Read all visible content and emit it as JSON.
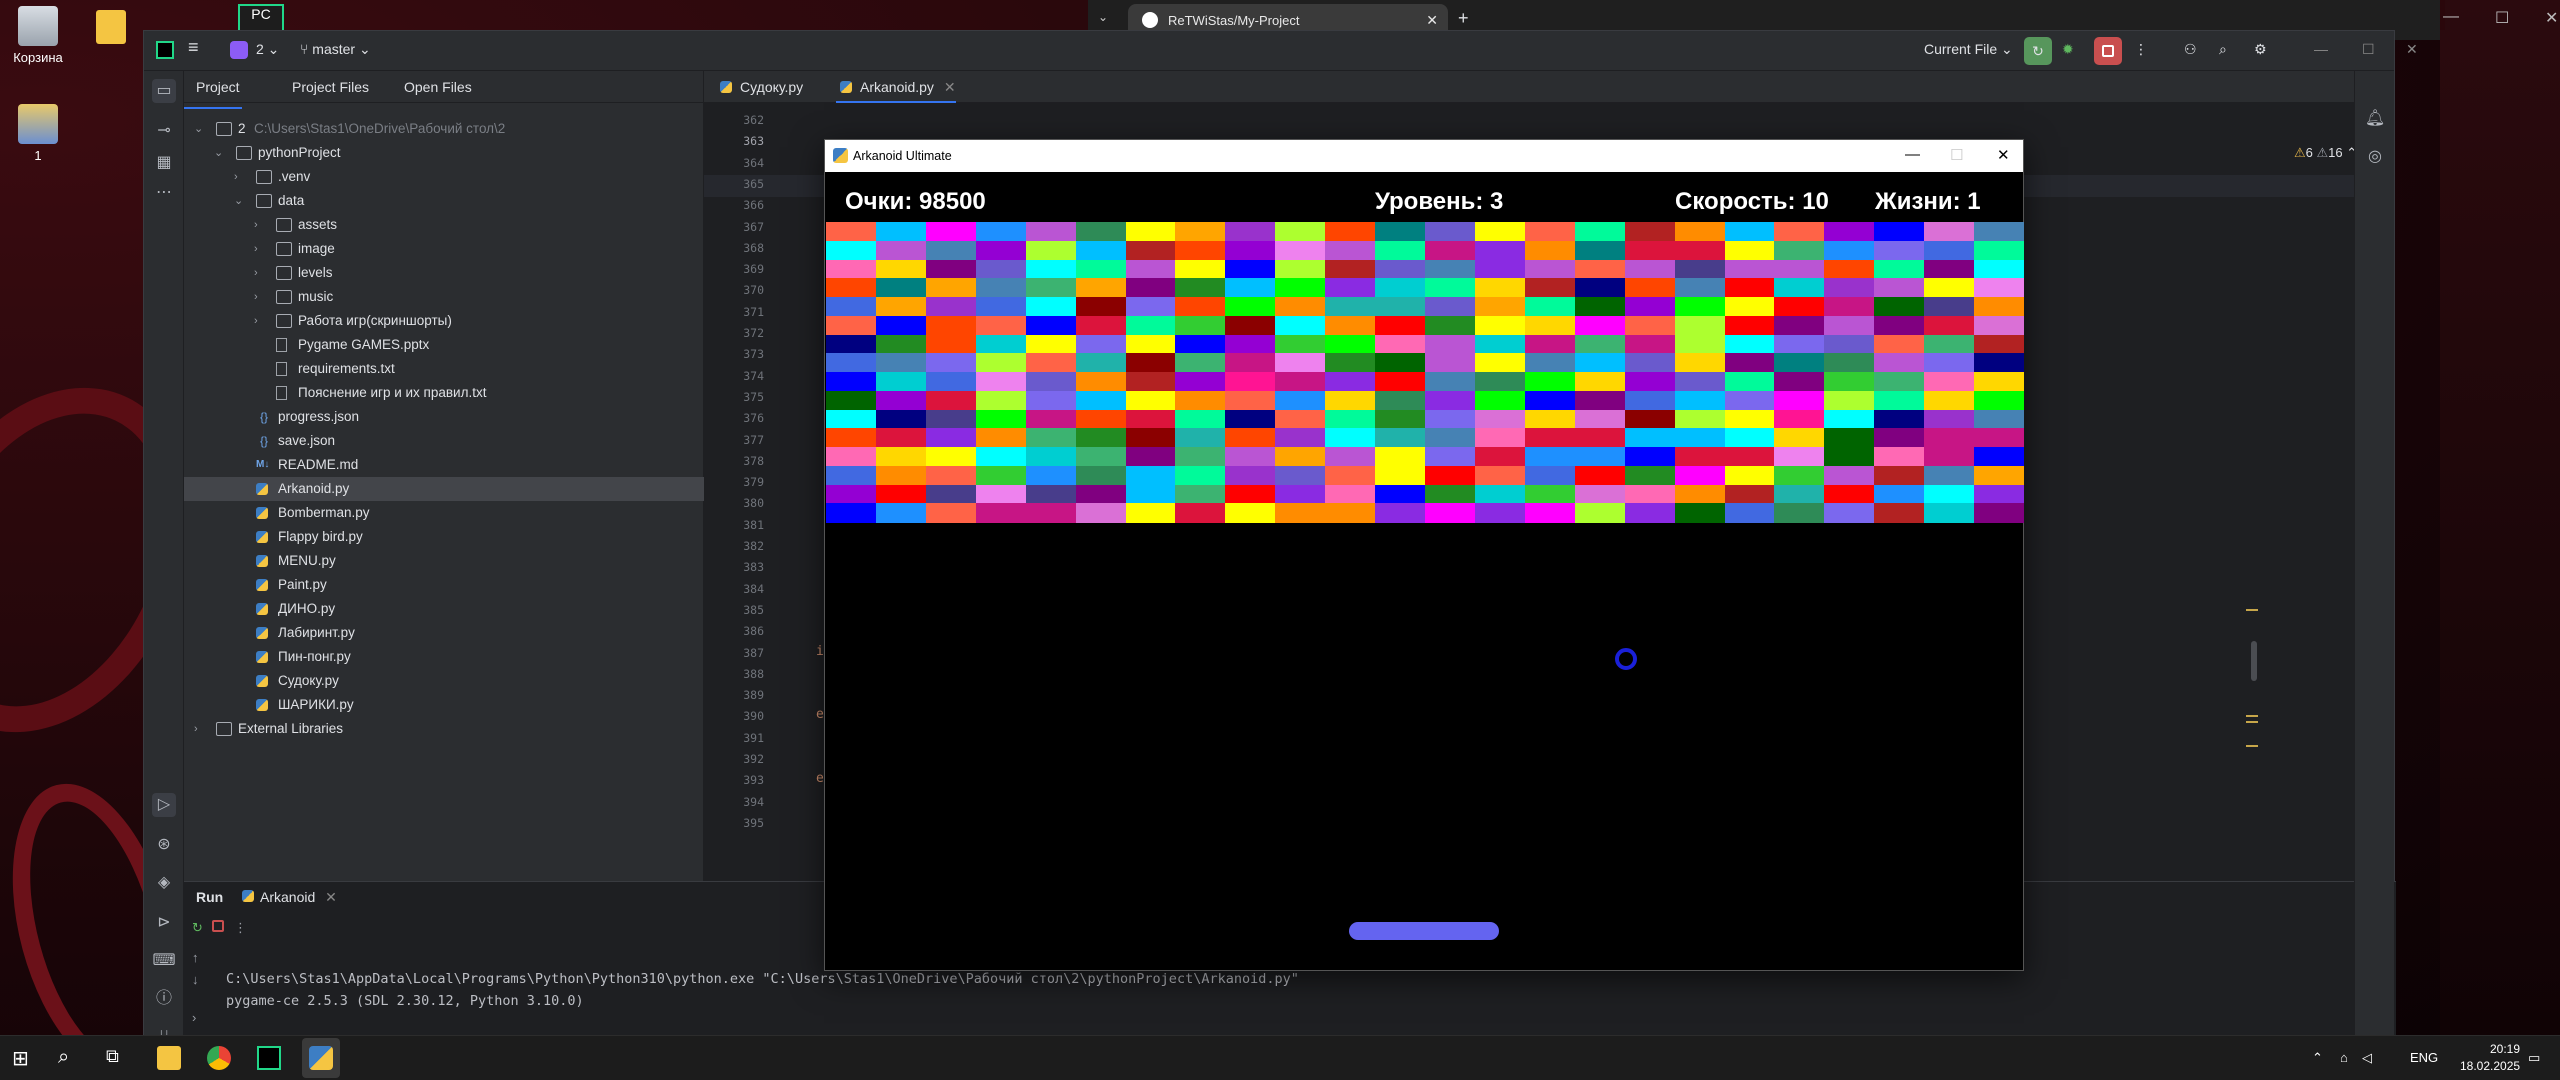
{
  "desktop": {
    "icons": [
      {
        "label": "Корзина"
      },
      {
        "label": "1"
      }
    ]
  },
  "browser": {
    "tab_title": "ReTWiStas/My-Project"
  },
  "ide": {
    "project_badge": "2",
    "branch": "master",
    "run_config": "Current File",
    "panel_tabs": [
      "Project",
      "Project Files",
      "Open Files"
    ],
    "tree": [
      {
        "label": "2",
        "suffix": "C:\\Users\\Stas1\\OneDrive\\Рабочий стол\\2",
        "depth": 0,
        "type": "folder",
        "open": true
      },
      {
        "label": "pythonProject",
        "depth": 1,
        "type": "folder",
        "open": true
      },
      {
        "label": ".venv",
        "depth": 2,
        "type": "folder",
        "open": false
      },
      {
        "label": "data",
        "depth": 2,
        "type": "folder",
        "open": true
      },
      {
        "label": "assets",
        "depth": 3,
        "type": "folder",
        "open": false
      },
      {
        "label": "image",
        "depth": 3,
        "type": "folder",
        "open": false
      },
      {
        "label": "levels",
        "depth": 3,
        "type": "folder",
        "open": false
      },
      {
        "label": "music",
        "depth": 3,
        "type": "folder",
        "open": false
      },
      {
        "label": "Работа игр(скриншорты)",
        "depth": 3,
        "type": "folder",
        "open": false
      },
      {
        "label": "Pygame GAMES.pptx",
        "depth": 3,
        "type": "file"
      },
      {
        "label": "requirements.txt",
        "depth": 3,
        "type": "file"
      },
      {
        "label": "Пояснение игр и их правил.txt",
        "depth": 3,
        "type": "file"
      },
      {
        "label": "progress.json",
        "depth": 2,
        "type": "json"
      },
      {
        "label": "save.json",
        "depth": 2,
        "type": "json"
      },
      {
        "label": "README.md",
        "depth": 2,
        "type": "md"
      },
      {
        "label": "Arkanoid.py",
        "depth": 2,
        "type": "py",
        "selected": true
      },
      {
        "label": "Bomberman.py",
        "depth": 2,
        "type": "py"
      },
      {
        "label": "Flappy bird.py",
        "depth": 2,
        "type": "py"
      },
      {
        "label": "MENU.py",
        "depth": 2,
        "type": "py"
      },
      {
        "label": "Paint.py",
        "depth": 2,
        "type": "py"
      },
      {
        "label": "ДИНО.py",
        "depth": 2,
        "type": "py"
      },
      {
        "label": "Лабиринт.py",
        "depth": 2,
        "type": "py"
      },
      {
        "label": "Пин-понг.py",
        "depth": 2,
        "type": "py"
      },
      {
        "label": "Судоку.py",
        "depth": 2,
        "type": "py"
      },
      {
        "label": "ШАРИКИ.py",
        "depth": 2,
        "type": "py"
      },
      {
        "label": "External Libraries",
        "depth": 0,
        "type": "lib"
      }
    ],
    "editor_tabs": [
      {
        "label": "Судоку.py",
        "active": false
      },
      {
        "label": "Arkanoid.py",
        "active": true
      }
    ],
    "line_numbers": [
      "362",
      "363",
      "364",
      "365",
      "366",
      "367",
      "368",
      "369",
      "370",
      "371",
      "372",
      "373",
      "374",
      "375",
      "376",
      "377",
      "378",
      "379",
      "380",
      "381",
      "382",
      "383",
      "384",
      "385",
      "386",
      "387",
      "388",
      "389",
      "390",
      "391",
      "392",
      "393",
      "394",
      "395"
    ],
    "current_line": "363",
    "code_fragments": [
      {
        "line": "387",
        "text": "i"
      },
      {
        "line": "390",
        "text": "e"
      },
      {
        "line": "393",
        "text": "e"
      }
    ],
    "warnings": "6",
    "weak_warnings": "16",
    "run": {
      "tab_run": "Run",
      "tab_config": "Arkanoid",
      "console": [
        "C:\\Users\\Stas1\\AppData\\Local\\Programs\\Python\\Python310\\python.exe \"C:\\Users\\Stas1\\OneDrive\\Рабочий стол\\2\\pythonProject\\Arkanoid.py\"",
        "pygame-ce 2.5.3 (SDL 2.30.12, Python 3.10.0)"
      ]
    }
  },
  "game": {
    "title": "Arkanoid Ultimate",
    "score": "Очки: 98500",
    "level": "Уровень: 3",
    "speed": "Скорость: 10",
    "lives": "Жизни: 1",
    "brick_colors": [
      "#ff0000",
      "#00ff00",
      "#0000ff",
      "#ffff00",
      "#ff00ff",
      "#00ffff",
      "#ff8c00",
      "#9400d3",
      "#ff1493",
      "#00fa9a",
      "#1e90ff",
      "#ff4500",
      "#32cd32",
      "#8a2be2",
      "#dc143c",
      "#00ced1",
      "#ffd700",
      "#adff2f",
      "#ba55d3",
      "#4169e1",
      "#ff6347",
      "#2e8b57",
      "#c71585",
      "#00bfff",
      "#9932cc",
      "#ff69b4",
      "#228b22",
      "#6a5acd",
      "#b22222",
      "#20b2aa",
      "#000080",
      "#800080",
      "#008080",
      "#8b0000",
      "#006400",
      "#483d8b",
      "#ffa500",
      "#7b68ee",
      "#3cb371",
      "#da70d6",
      "#4682b4",
      "#ee82ee"
    ],
    "rows": 16,
    "cols": 24
  },
  "taskbar": {
    "lang": "ENG",
    "time": "20:19",
    "date": "18.02.2025"
  }
}
